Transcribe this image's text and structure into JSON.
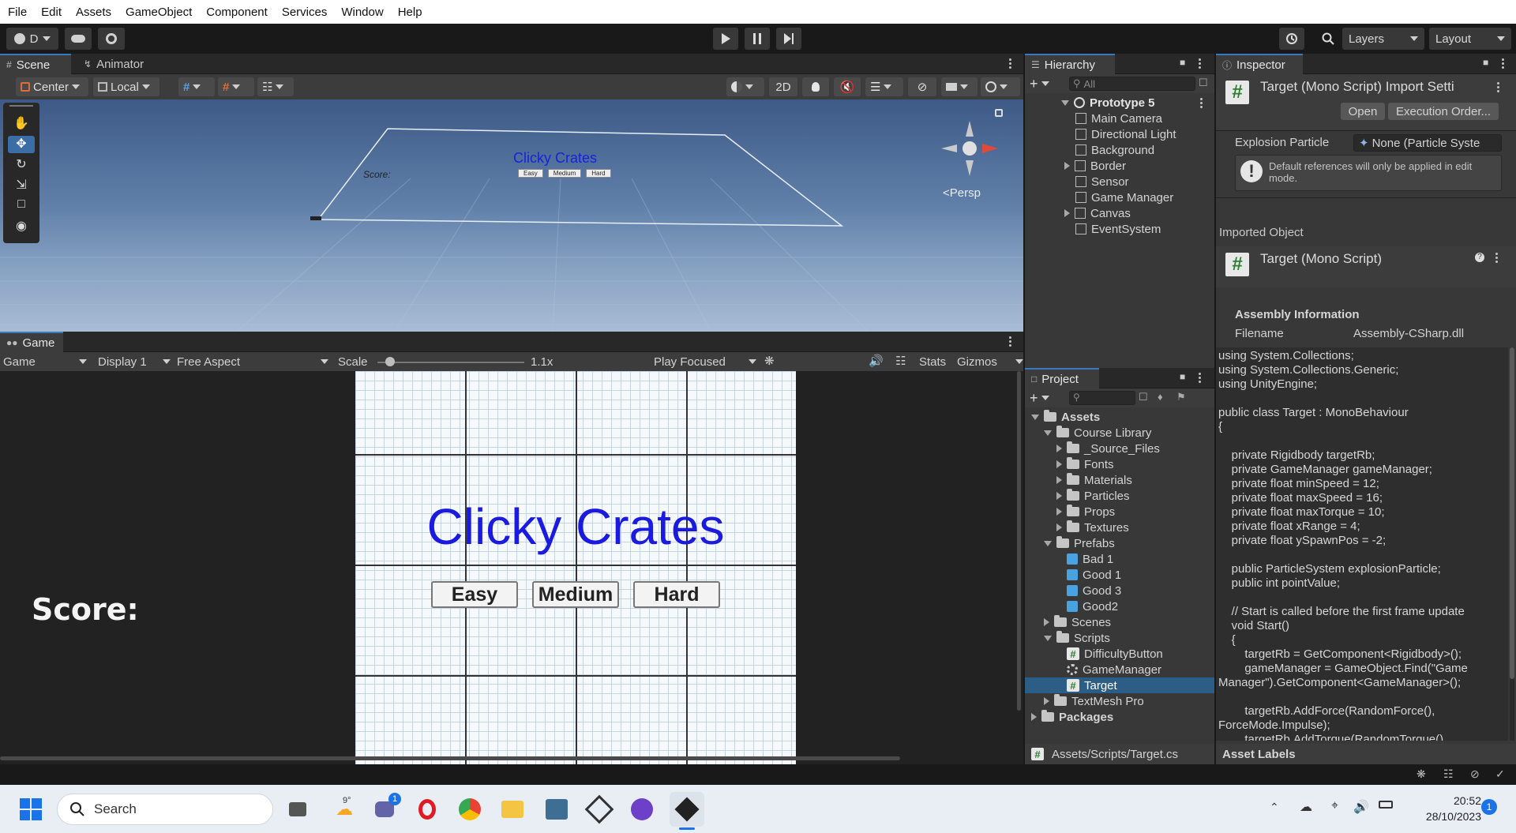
{
  "menu": [
    "File",
    "Edit",
    "Assets",
    "GameObject",
    "Component",
    "Services",
    "Window",
    "Help"
  ],
  "toolbar": {
    "account": "D",
    "layers": "Layers",
    "layout": "Layout"
  },
  "scene": {
    "tabs": [
      "Scene",
      "Animator"
    ],
    "pivot": "Center",
    "space": "Local",
    "mode_2d": "2D",
    "persp": "<Persp",
    "canvas_title": "Clicky Crates",
    "canvas_score": "Score:",
    "canvas_buttons": [
      "Easy",
      "Medium",
      "Hard"
    ]
  },
  "game": {
    "tab": "Game",
    "mode": "Game",
    "display": "Display 1",
    "aspect": "Free Aspect",
    "scale_label": "Scale",
    "scale_value": "1.1x",
    "play_focused": "Play Focused",
    "stats": "Stats",
    "gizmos": "Gizmos",
    "title": "Clicky Crates",
    "score": "Score:",
    "buttons": [
      "Easy",
      "Medium",
      "Hard"
    ]
  },
  "hierarchy": {
    "tab": "Hierarchy",
    "search_placeholder": "All",
    "root": "Prototype 5",
    "items": [
      {
        "label": "Main Camera",
        "expandable": false
      },
      {
        "label": "Directional Light",
        "expandable": false
      },
      {
        "label": "Background",
        "expandable": false
      },
      {
        "label": "Border",
        "expandable": true
      },
      {
        "label": "Sensor",
        "expandable": false
      },
      {
        "label": "Game Manager",
        "expandable": false
      },
      {
        "label": "Canvas",
        "expandable": true
      },
      {
        "label": "EventSystem",
        "expandable": false
      }
    ]
  },
  "project": {
    "tab": "Project",
    "path": "Assets/Scripts/Target.cs",
    "tree": {
      "assets": "Assets",
      "course_library": "Course Library",
      "course_children": [
        "_Source_Files",
        "Fonts",
        "Materials",
        "Particles",
        "Props",
        "Textures"
      ],
      "prefabs": "Prefabs",
      "prefab_children": [
        "Bad 1",
        "Good 1",
        "Good 3",
        "Good2"
      ],
      "scenes": "Scenes",
      "scripts": "Scripts",
      "script_children": [
        "DifficultyButton",
        "GameManager",
        "Target"
      ],
      "textmesh": "TextMesh Pro",
      "packages": "Packages"
    }
  },
  "inspector": {
    "tab": "Inspector",
    "title": "Target (Mono Script) Import Setti",
    "open": "Open",
    "execution_order": "Execution Order...",
    "explosion_label": "Explosion Particle",
    "explosion_value": "None (Particle Syste",
    "warning": "Default references will only be applied in edit mode.",
    "imported_object": "Imported Object",
    "script_title": "Target (Mono Script)",
    "assembly_header": "Assembly Information",
    "filename_label": "Filename",
    "filename_value": "Assembly-CSharp.dll",
    "asset_labels": "Asset Labels",
    "code": "using System.Collections;\nusing System.Collections.Generic;\nusing UnityEngine;\n\npublic class Target : MonoBehaviour\n{\n\n    private Rigidbody targetRb;\n    private GameManager gameManager;\n    private float minSpeed = 12;\n    private float maxSpeed = 16;\n    private float maxTorque = 10;\n    private float xRange = 4;\n    private float ySpawnPos = -2;\n\n    public ParticleSystem explosionParticle;\n    public int pointValue;\n\n    // Start is called before the first frame update\n    void Start()\n    {\n        targetRb = GetComponent<Rigidbody>();\n        gameManager = GameObject.Find(\"Game\nManager\").GetComponent<GameManager>();\n\n        targetRb.AddForce(RandomForce(),\nForceMode.Impulse);\n        targetRb.AddTorque(RandomTorque()"
  },
  "taskbar": {
    "search": "Search",
    "weather": "9°",
    "chat_badge": "1",
    "time": "20:52",
    "date": "28/10/2023",
    "notification_badge": "1"
  }
}
